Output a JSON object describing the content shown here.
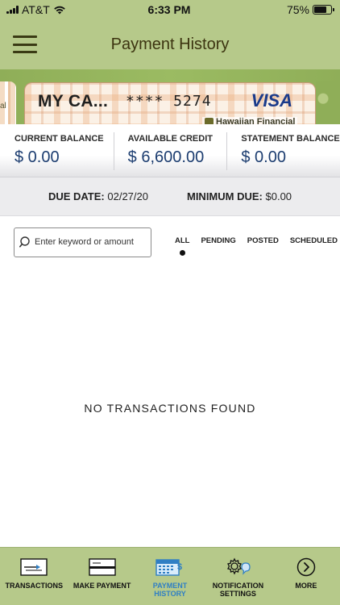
{
  "status_bar": {
    "carrier": "AT&T",
    "time": "6:33 PM",
    "battery_percent": "75%",
    "battery_level": 0.75
  },
  "header": {
    "title": "Payment History",
    "menu_icon": "hamburger-menu-icon"
  },
  "card": {
    "name": "MY CA...",
    "number": "**** 5274",
    "brand": "VISA",
    "bank": "Hawaiian Financial",
    "side_text": "al"
  },
  "balances": [
    {
      "label": "CURRENT BALANCE",
      "value": "$ 0.00"
    },
    {
      "label": "AVAILABLE CREDIT",
      "value": "$ 6,600.00"
    },
    {
      "label": "STATEMENT BALANCE",
      "value": "$ 0.00"
    }
  ],
  "due": {
    "due_date_label": "DUE DATE:",
    "due_date_value": "02/27/20",
    "minimum_due_label": "MINIMUM DUE:",
    "minimum_due_value": "$0.00"
  },
  "search": {
    "placeholder": "Enter keyword or amount",
    "value": ""
  },
  "filters": [
    {
      "label": "ALL",
      "active": true
    },
    {
      "label": "PENDING",
      "active": false
    },
    {
      "label": "POSTED",
      "active": false
    },
    {
      "label": "SCHEDULED",
      "active": false
    }
  ],
  "empty_message": "NO TRANSACTIONS FOUND",
  "bottom_nav": [
    {
      "label": "TRANSACTIONS",
      "icon": "transactions-icon",
      "active": false
    },
    {
      "label": "MAKE PAYMENT",
      "icon": "card-payment-icon",
      "active": false
    },
    {
      "label_line1": "PAYMENT",
      "label_line2": "HISTORY",
      "icon": "calendar-icon",
      "active": true
    },
    {
      "label_line1": "NOTIFICATION",
      "label_line2": "SETTINGS",
      "icon": "gear-chat-icon",
      "active": false
    },
    {
      "label": "MORE",
      "icon": "chevron-right-circle-icon",
      "active": false
    }
  ],
  "colors": {
    "brand_green": "#b6c98a",
    "balance_blue": "#1c3d70",
    "active_nav_blue": "#2f7fc4"
  }
}
